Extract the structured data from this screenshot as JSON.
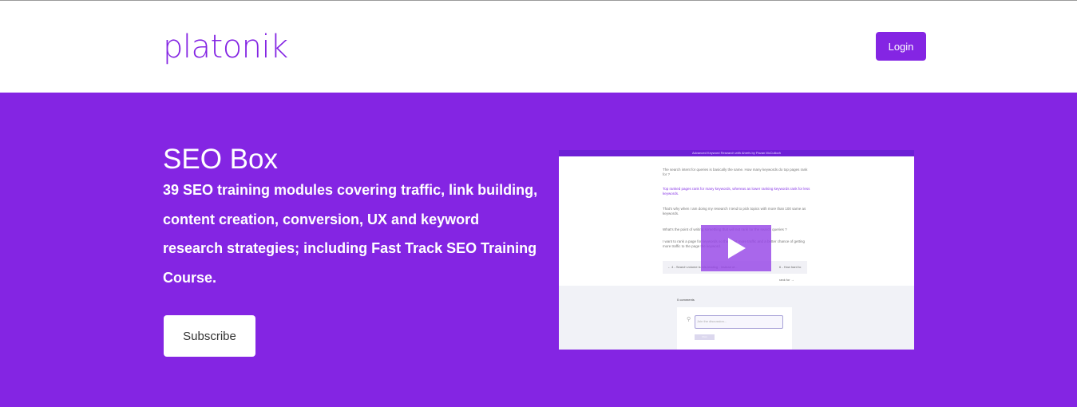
{
  "header": {
    "logo_text": "platonik",
    "login_label": "Login"
  },
  "hero": {
    "title": "SEO Box",
    "description": "39 SEO training modules covering traffic, link building, content creation, conversion, UX and keyword research strategies; including Fast Track SEO Training Course.",
    "subscribe_label": "Subscribe"
  },
  "video": {
    "bar_title": "Advanced Keyword Research with Ahrefs by Pavan McCulloch",
    "para1": "The search intent for queries is basically the same. How many keywords do top pages rank for ?",
    "para2": "Top ranked pages rank for many keywords, whereas as lower ranking keywords rank for less keywords.",
    "para3": "That's why when I am doing my research I tend to pick topics with more than 100 same as keywords.",
    "para4": "What's the point of writing something that will not rank for the search queries ?",
    "para5": "I want to rank a page for keywords so that I get more traffic and a better chance of getting more traffic to the page the keyword.",
    "nav_prev": "← 4 - Search volume is mis-leading - Instead of...",
    "nav_next": "6 - How hard to rank for →",
    "comments_label": "0 comments",
    "comment_placeholder": "Join the discussion...",
    "post_label": "Post",
    "play_icon": "play-icon",
    "pin_icon": "location-pin-icon"
  },
  "colors": {
    "brand": "#8425e3",
    "white": "#ffffff"
  }
}
